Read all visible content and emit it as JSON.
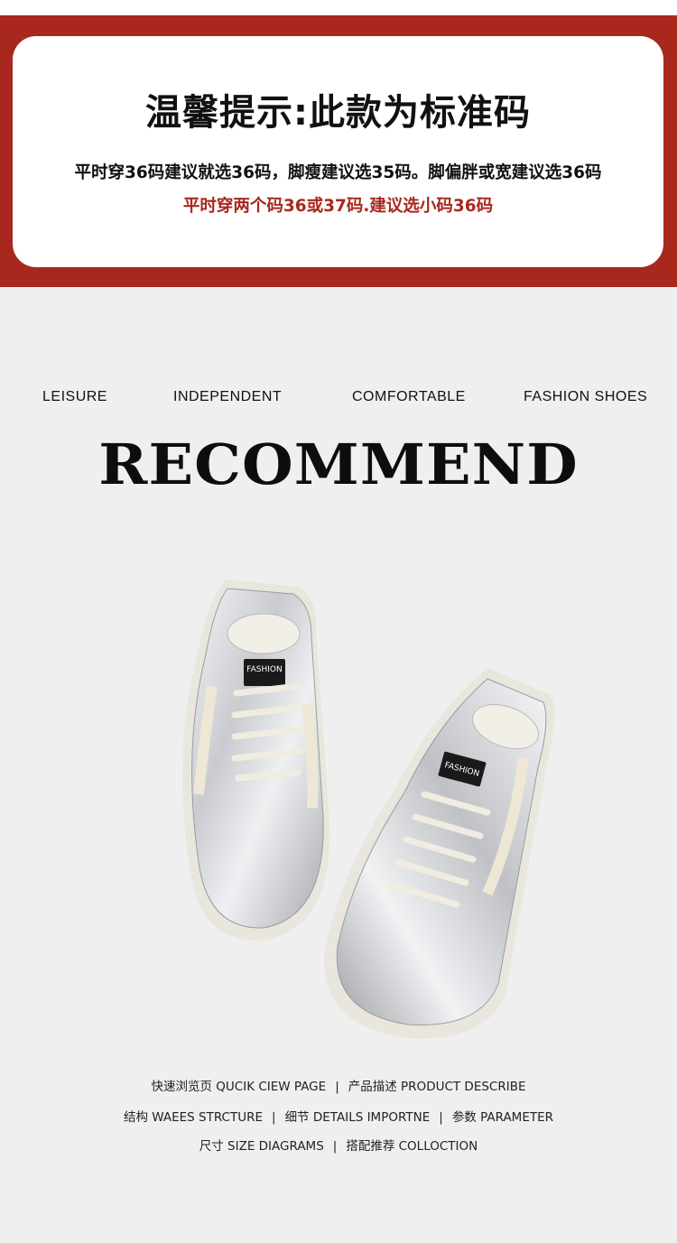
{
  "notice": {
    "title": "温馨提示:此款为标准码",
    "line1": "平时穿36码建议就选36码，脚瘦建议选35码。脚偏胖或宽建议选36码",
    "line2": "平时穿两个码36或37码.建议选小码36码",
    "accent_color": "#a8281e"
  },
  "tags": [
    "LEISURE",
    "INDEPENDENT",
    "COMFORTABLE",
    "FASHION SHOES"
  ],
  "recommend_title": "RECOMMEND",
  "shoe_labels": {
    "left": "FASHION",
    "right": "FASHION"
  },
  "footer": {
    "row1": [
      "快速浏览页 QUCIK CIEW PAGE",
      "产品描述 PRODUCT DESCRIBE"
    ],
    "row2": [
      "结构 WAEES STRCTURE",
      "细节 DETAILS IMPORTNE",
      "参数 PARAMETER"
    ],
    "row3": [
      "尺寸 SIZE DIAGRAMS",
      "搭配推荐 COLLOCTION"
    ],
    "separator": "|"
  }
}
